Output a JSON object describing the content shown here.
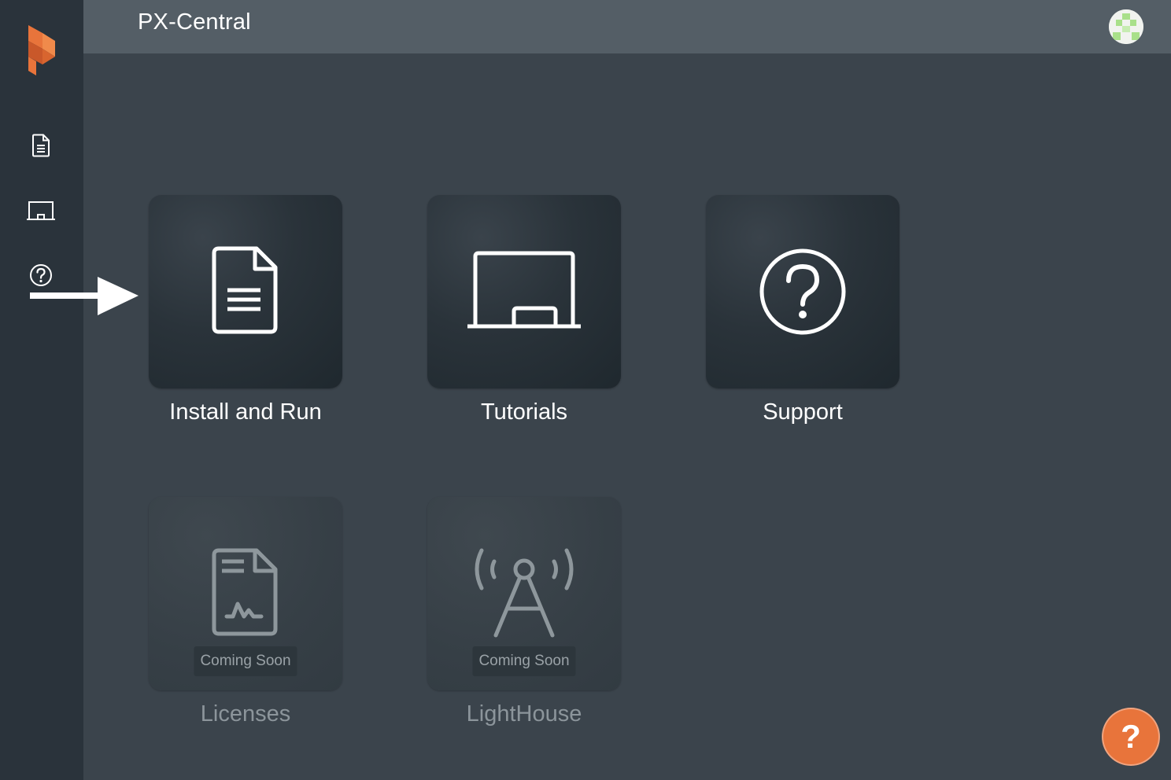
{
  "app": {
    "title": "PX-Central"
  },
  "sidebar": {
    "items": [
      {
        "name": "install-and-run",
        "icon": "document-icon"
      },
      {
        "name": "tutorials",
        "icon": "chalkboard-icon"
      },
      {
        "name": "support",
        "icon": "question-circle-icon"
      }
    ]
  },
  "tiles": [
    {
      "label": "Install and Run",
      "icon": "document-icon",
      "enabled": true
    },
    {
      "label": "Tutorials",
      "icon": "chalkboard-icon",
      "enabled": true
    },
    {
      "label": "Support",
      "icon": "question-circle-icon",
      "enabled": true
    },
    {
      "label": "Licenses",
      "icon": "license-icon",
      "enabled": false,
      "badge": "Coming Soon"
    },
    {
      "label": "LightHouse",
      "icon": "antenna-icon",
      "enabled": false,
      "badge": "Coming Soon"
    }
  ],
  "help_fab": {
    "glyph": "?"
  },
  "colors": {
    "accent": "#e8743b",
    "sidebar": "#2a333b",
    "topbar": "#545e66",
    "background": "#3b444c"
  }
}
